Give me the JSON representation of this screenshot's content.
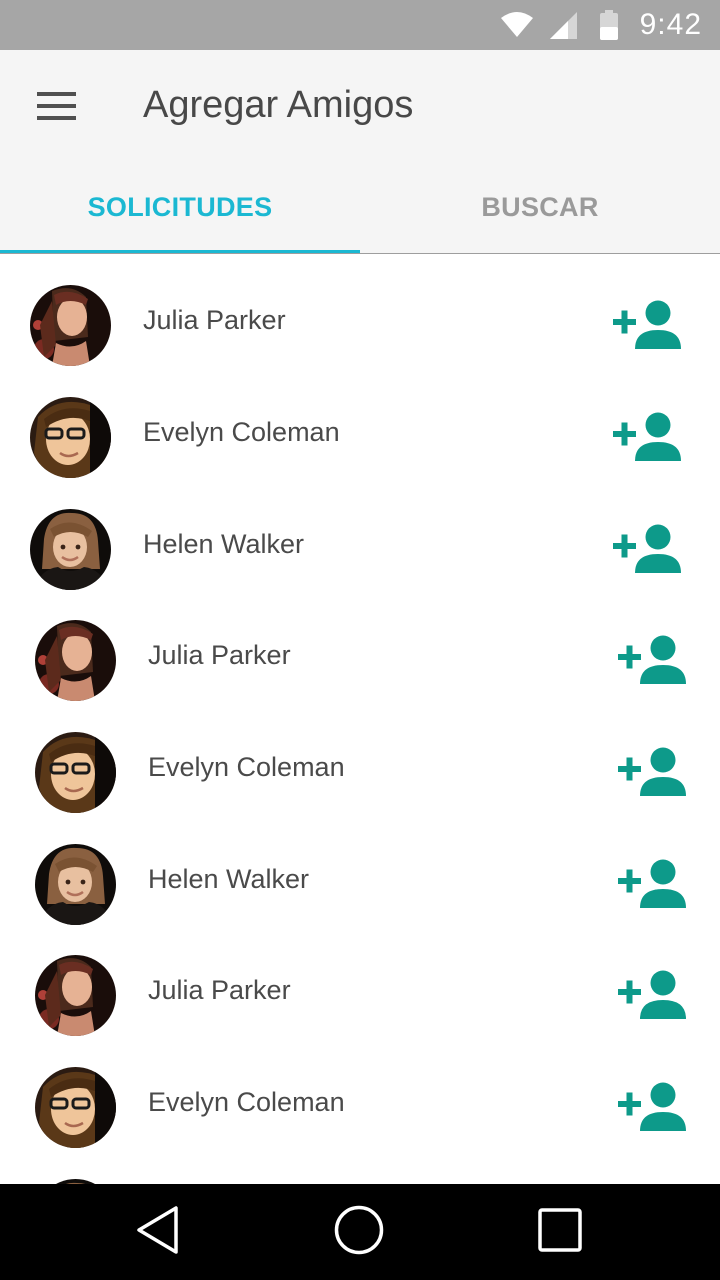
{
  "status_bar": {
    "time": "9:42",
    "icons": [
      "wifi-icon",
      "signal-icon",
      "battery-icon"
    ]
  },
  "app_bar": {
    "menu_icon": "hamburger-menu-icon",
    "title": "Agregar Amigos"
  },
  "tabs": [
    {
      "label": "SOLICITUDES",
      "active": true
    },
    {
      "label": "BUSCAR",
      "active": false
    }
  ],
  "colors": {
    "accent": "#1bb8d2",
    "add_icon": "#0d9a8a",
    "status_bar": "#a6a6a6",
    "app_bar": "#f5f5f5",
    "nav_bar": "#000000"
  },
  "friend_requests": [
    {
      "name": "Julia Parker",
      "action_icon": "add-person-icon"
    },
    {
      "name": "Evelyn Coleman",
      "action_icon": "add-person-icon"
    },
    {
      "name": "Helen Walker",
      "action_icon": "add-person-icon"
    },
    {
      "name": "Julia Parker",
      "action_icon": "add-person-icon"
    },
    {
      "name": "Evelyn Coleman",
      "action_icon": "add-person-icon"
    },
    {
      "name": "Helen Walker",
      "action_icon": "add-person-icon"
    },
    {
      "name": "Julia Parker",
      "action_icon": "add-person-icon"
    },
    {
      "name": "Evelyn Coleman",
      "action_icon": "add-person-icon"
    }
  ],
  "nav_bar": {
    "buttons": [
      "back-icon",
      "home-icon",
      "recents-icon"
    ]
  }
}
